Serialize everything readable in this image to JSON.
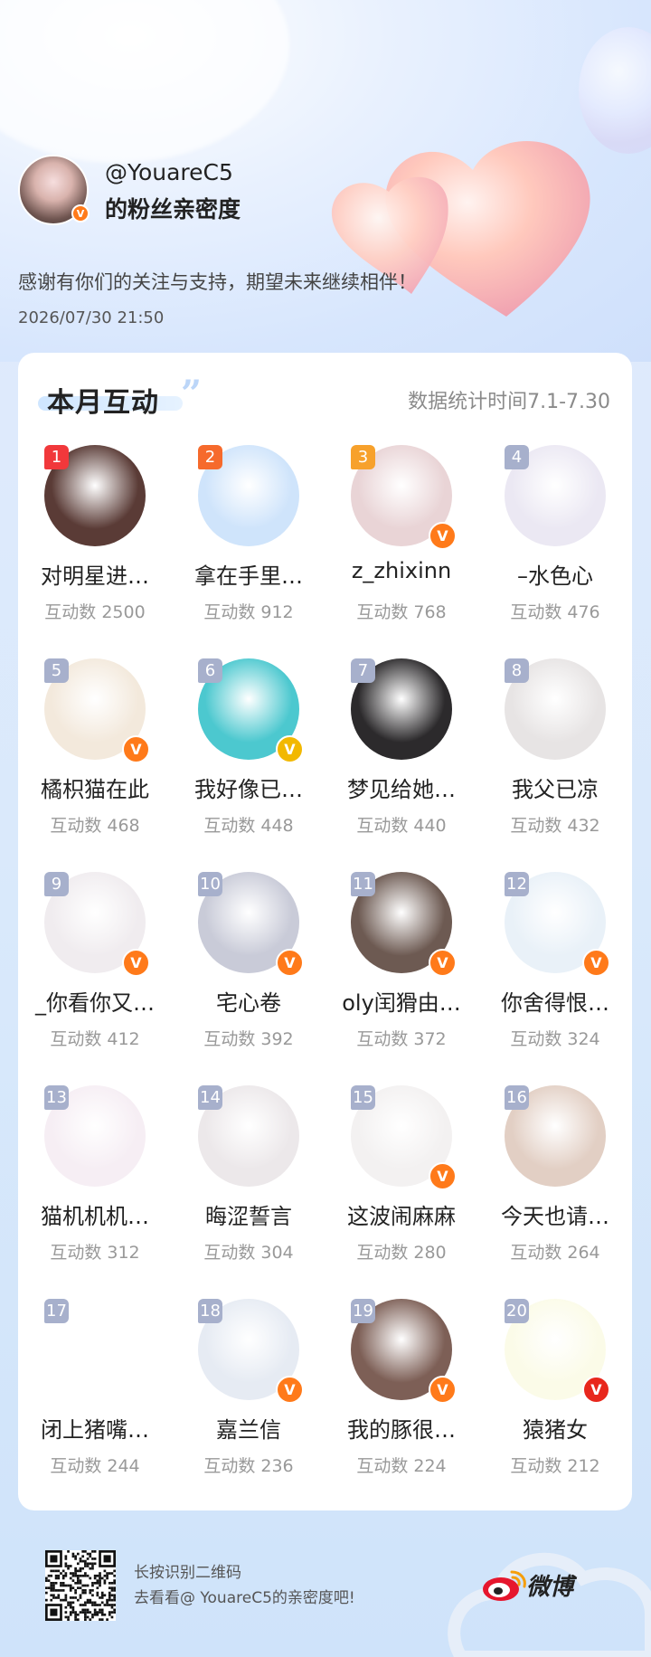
{
  "header": {
    "handle": "@YouareC5",
    "subtitle": "的粉丝亲密度",
    "thanks": "感谢有你们的关注与支持，期望未来继续相伴！",
    "timestamp": "2026/07/30 21:50",
    "verified_badge": "V"
  },
  "card": {
    "title": "本月互动",
    "quote": "”",
    "period": "数据统计时间7.1-7.30"
  },
  "fans": [
    {
      "rank": "1",
      "name": "对明星进…",
      "count": "互动数 2500",
      "badge": "",
      "color": "#5a3b36"
    },
    {
      "rank": "2",
      "name": "拿在手里…",
      "count": "互动数 912",
      "badge": "",
      "color": "#cfe4fb"
    },
    {
      "rank": "3",
      "name": "z_zhixinn",
      "count": "互动数 768",
      "badge": "V",
      "color": "#e9d4d6"
    },
    {
      "rank": "4",
      "name": "–水色心",
      "count": "互动数 476",
      "badge": "",
      "color": "#ebe8f3"
    },
    {
      "rank": "5",
      "name": "橘枳猫在此",
      "count": "互动数 468",
      "badge": "V",
      "color": "#f3e9dc"
    },
    {
      "rank": "6",
      "name": "我好像已…",
      "count": "互动数 448",
      "badge": "V",
      "color": "#4cc8cf"
    },
    {
      "rank": "7",
      "name": "梦见给她…",
      "count": "互动数 440",
      "badge": "",
      "color": "#2c2a2c"
    },
    {
      "rank": "8",
      "name": "我父已凉",
      "count": "互动数 432",
      "badge": "",
      "color": "#e7e4e4"
    },
    {
      "rank": "9",
      "name": "_你看你又…",
      "count": "互动数 412",
      "badge": "V",
      "color": "#f0ecef"
    },
    {
      "rank": "10",
      "name": "宅心卷",
      "count": "互动数 392",
      "badge": "V",
      "color": "#c9cbd8"
    },
    {
      "rank": "11",
      "name": "oly闰猾由…",
      "count": "互动数 372",
      "badge": "V",
      "color": "#6d5a52"
    },
    {
      "rank": "12",
      "name": "你舍得恨…",
      "count": "互动数 324",
      "badge": "V",
      "color": "#e9f1f8"
    },
    {
      "rank": "13",
      "name": "猫机机机…",
      "count": "互动数 312",
      "badge": "",
      "color": "#f6eef4"
    },
    {
      "rank": "14",
      "name": "晦涩誓言",
      "count": "互动数 304",
      "badge": "",
      "color": "#ece8ea"
    },
    {
      "rank": "15",
      "name": "这波闹麻麻",
      "count": "互动数 280",
      "badge": "V",
      "color": "#f3f1f1"
    },
    {
      "rank": "16",
      "name": "今天也请…",
      "count": "互动数 264",
      "badge": "",
      "color": "#e2cfc4"
    },
    {
      "rank": "17",
      "name": "闭上猪嘴…",
      "count": "互动数 244",
      "badge": "",
      "color": "#ffffff"
    },
    {
      "rank": "18",
      "name": "嘉兰信",
      "count": "互动数 236",
      "badge": "V",
      "color": "#e6ebf3"
    },
    {
      "rank": "19",
      "name": "我的豚很…",
      "count": "互动数 224",
      "badge": "V",
      "color": "#7d5f56"
    },
    {
      "rank": "20",
      "name": "猿猪女",
      "count": "互动数 212",
      "badge": "V",
      "color": "#fbfbe8"
    }
  ],
  "footer": {
    "line1": "长按识别二维码",
    "line2": "去看看@ YouareC5的亲密度吧!",
    "brand": "微博"
  }
}
